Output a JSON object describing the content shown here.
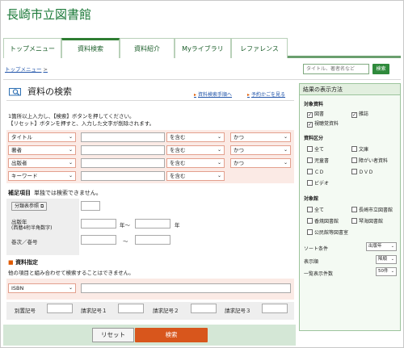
{
  "site": {
    "title": "長崎市立図書館"
  },
  "tabs": [
    {
      "label": "トップメニュー",
      "active": false
    },
    {
      "label": "資料検索",
      "active": true
    },
    {
      "label": "資料紹介",
      "active": false
    },
    {
      "label": "Myライブラリ",
      "active": false
    },
    {
      "label": "レファレンス",
      "active": false
    }
  ],
  "breadcrumb": {
    "home": "トップメニュー",
    "sep": ">"
  },
  "top_search": {
    "placeholder": "タイトル、著者名など",
    "button": "検索"
  },
  "main": {
    "title": "資料の検索",
    "link_procedure": "資料検索手順へ",
    "link_cart": "予約かごを見る",
    "desc1": "1箇所以上入力し、【検索】ボタンを押してください。",
    "desc2": "【リセット】ボタンを押すと、入力した文字が削除されます。",
    "rows": [
      {
        "field": "タイトル",
        "match": "を含む",
        "op": "かつ"
      },
      {
        "field": "著者",
        "match": "を含む",
        "op": "かつ"
      },
      {
        "field": "出版者",
        "match": "を含む",
        "op": "かつ"
      },
      {
        "field": "キーワード",
        "match": "を含む",
        "op": ""
      }
    ],
    "supp_title": "補足項目",
    "supp_note": "単独では検索できません。",
    "class_button": "分類表参照",
    "pub_year_label": "出版年",
    "pub_year_sub": "(西暦4桁半角数字)",
    "year_from": "年～",
    "year_to": "年",
    "volume_label": "巻次／巻号",
    "tilde": "～",
    "resource_title": "資料指定",
    "resource_note": "他の項目と組み合わせて検索することはできません。",
    "isbn": "ISBN",
    "sep_label": "別置記号",
    "call1": "請求記号１",
    "call2": "請求記号２",
    "call3": "請求記号３",
    "reset": "リセット",
    "search": "検索"
  },
  "sidebar": {
    "title": "結果の表示方法",
    "material_label": "対象資料",
    "material": [
      {
        "label": "図書",
        "checked": true
      },
      {
        "label": "雑誌",
        "checked": true
      },
      {
        "label": "視聴覚資料",
        "checked": true
      }
    ],
    "category_label": "資料区分",
    "category": [
      {
        "label": "全て",
        "checked": false
      },
      {
        "label": "文庫",
        "checked": false
      },
      {
        "label": "児童書",
        "checked": false
      },
      {
        "label": "障がい者資料",
        "checked": false
      },
      {
        "label": "ＣＤ",
        "checked": false
      },
      {
        "label": "ＤＶＤ",
        "checked": false
      },
      {
        "label": "ビデオ",
        "checked": false
      }
    ],
    "library_label": "対象館",
    "library": [
      {
        "label": "全て",
        "checked": false
      },
      {
        "label": "長崎市立図書館",
        "checked": false
      },
      {
        "label": "香焼図書館",
        "checked": false
      },
      {
        "label": "琴海図書館",
        "checked": false
      },
      {
        "label": "公民館等図書室",
        "checked": false
      }
    ],
    "sort_label": "ソート条件",
    "sort_value": "出版年",
    "order_label": "表示順",
    "order_value": "降順",
    "count_label": "一覧表示件数",
    "count_value": "50件"
  },
  "colors": {
    "brand": "#1d7a3a",
    "accent": "#d8561c",
    "tab_rule": "#6a9f6e"
  }
}
